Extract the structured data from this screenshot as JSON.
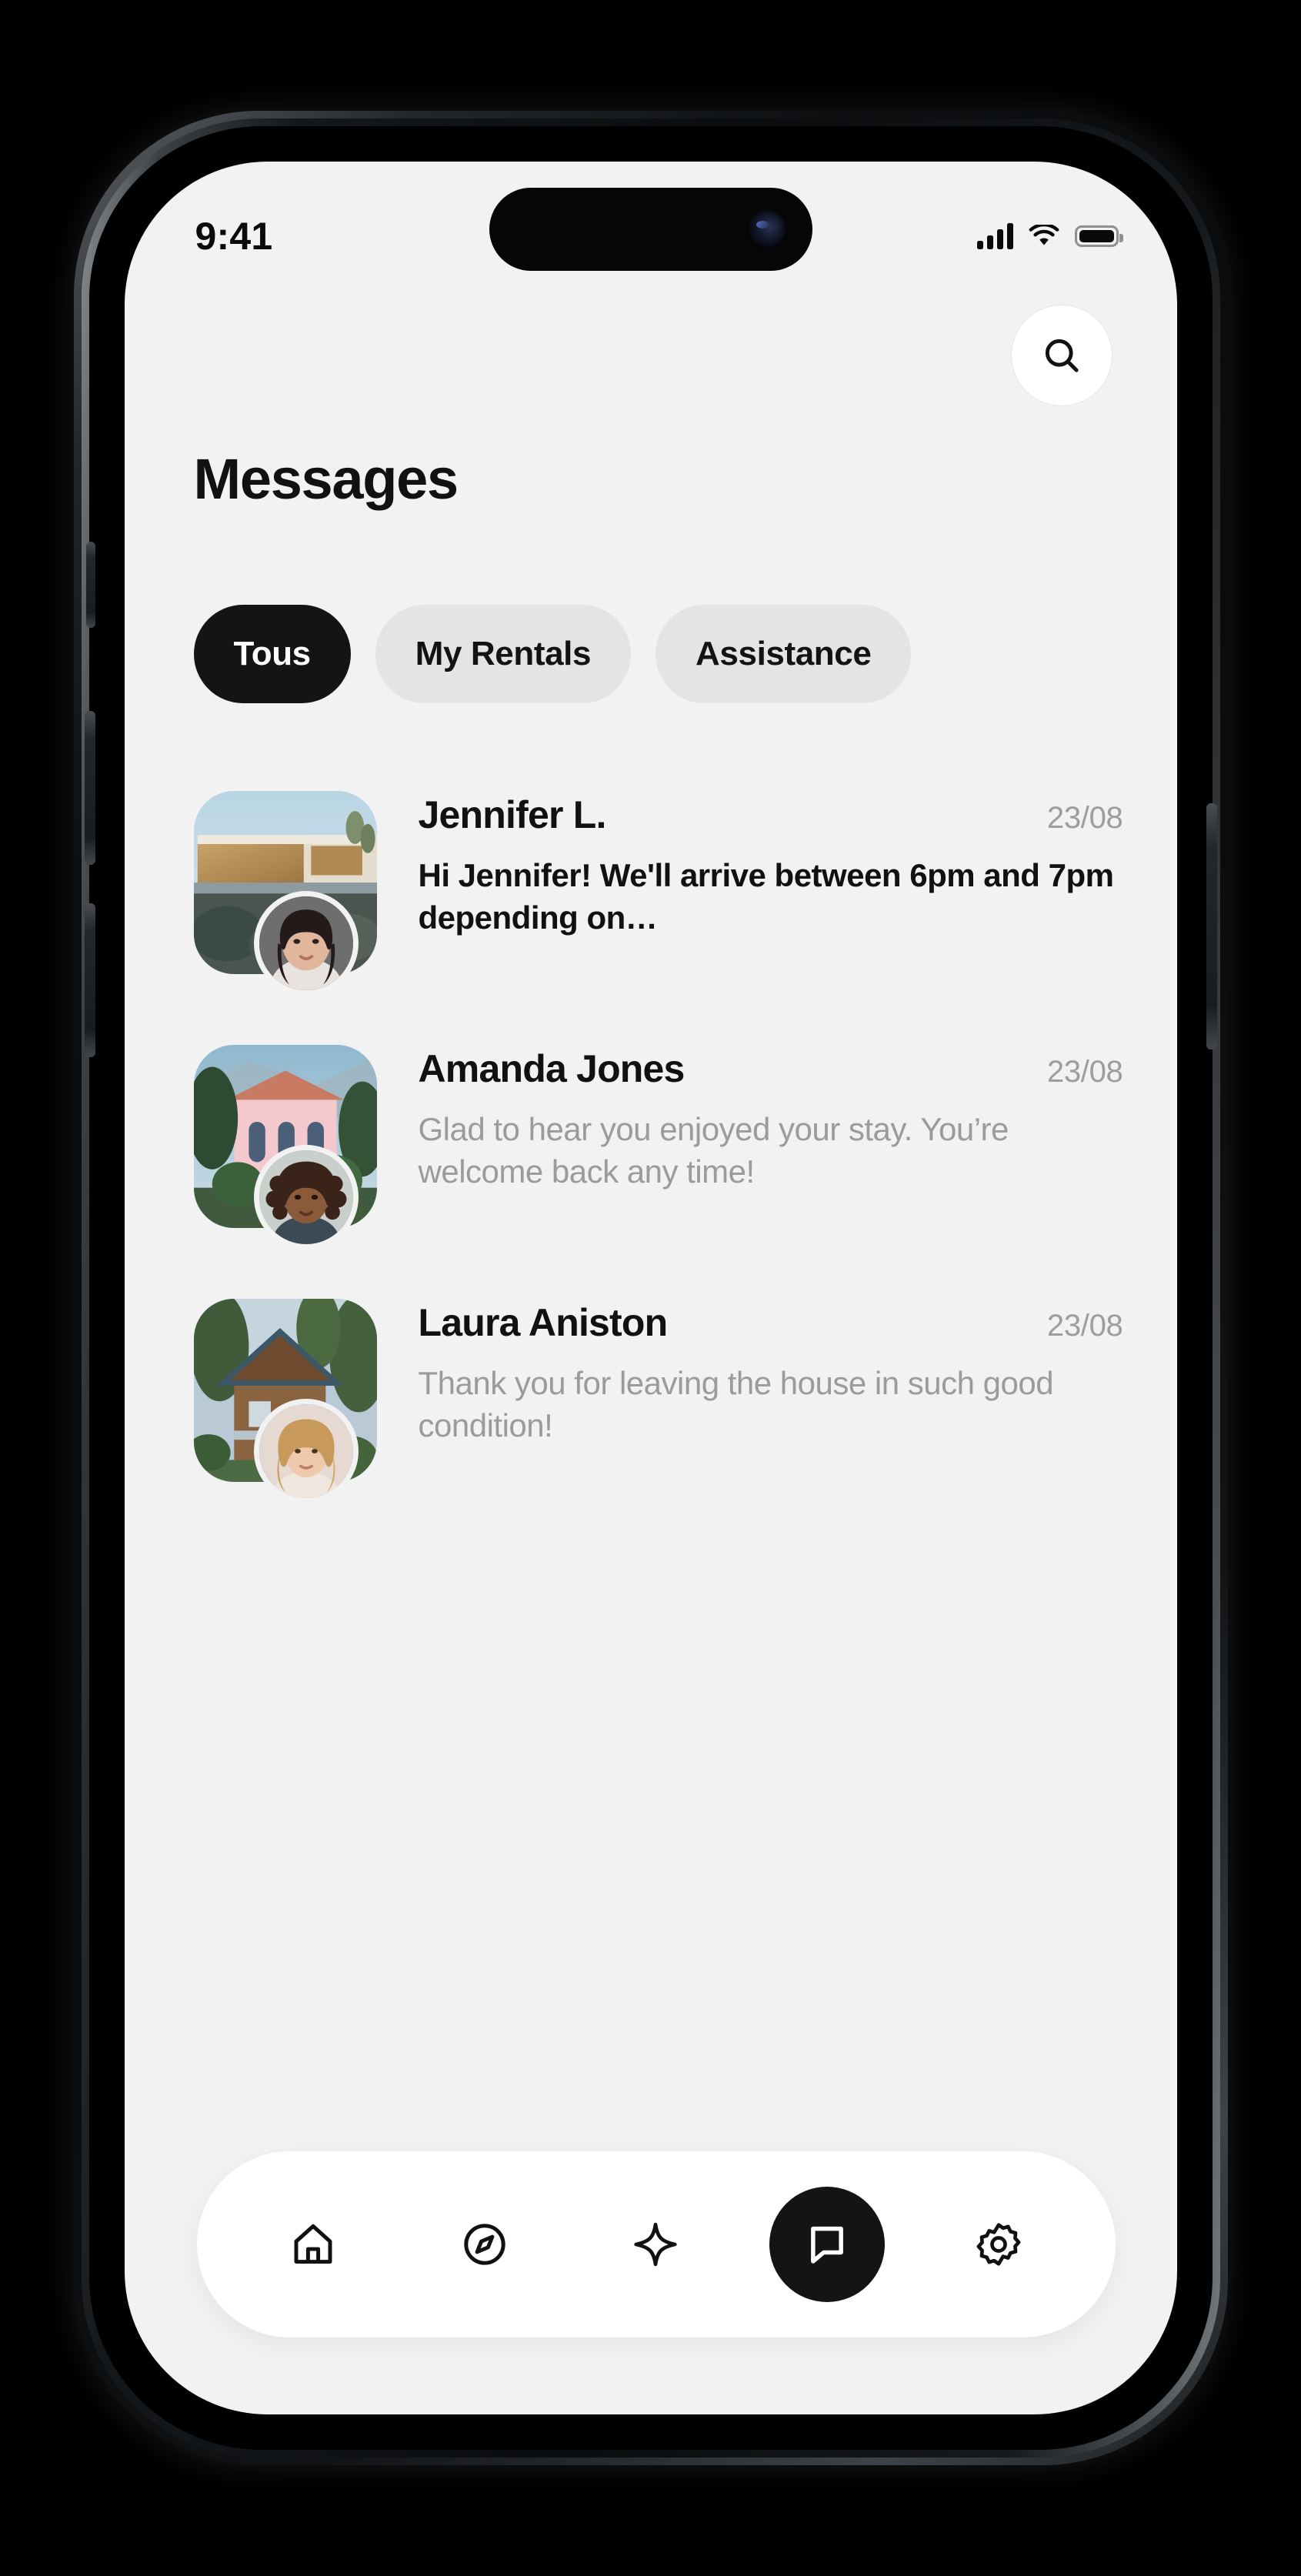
{
  "status_bar": {
    "time": "9:41",
    "signal_icon": "cellular-signal-icon",
    "wifi_icon": "wifi-icon",
    "battery_icon": "battery-full-icon"
  },
  "header": {
    "title": "Messages",
    "search_icon": "search-icon"
  },
  "tabs": [
    {
      "label": "Tous",
      "active": true
    },
    {
      "label": "My Rentals",
      "active": false
    },
    {
      "label": "Assistance",
      "active": false
    }
  ],
  "conversations": [
    {
      "name": "Jennifer L.",
      "date": "23/08",
      "preview": "Hi Jennifer! We'll arrive between 6pm and 7pm depending on…",
      "unread": true,
      "property_image": "modern-desert-villa-thumbnail",
      "avatar_image": "jennifer-avatar"
    },
    {
      "name": "Amanda Jones",
      "date": "23/08",
      "preview": "Glad to hear you enjoyed your stay. You’re welcome back any time!",
      "unread": false,
      "property_image": "pink-mediterranean-villa-thumbnail",
      "avatar_image": "amanda-avatar"
    },
    {
      "name": "Laura Aniston",
      "date": "23/08",
      "preview": "Thank you for leaving the house in such good condition!",
      "unread": false,
      "property_image": "forest-wooden-chalet-thumbnail",
      "avatar_image": "laura-avatar"
    }
  ],
  "bottom_nav": [
    {
      "icon": "home-icon",
      "active": false
    },
    {
      "icon": "compass-icon",
      "active": false
    },
    {
      "icon": "sparkle-icon",
      "active": false
    },
    {
      "icon": "chat-bubble-icon",
      "active": true
    },
    {
      "icon": "gear-icon",
      "active": false
    }
  ],
  "colors": {
    "screen_background": "#f2f2f2",
    "accent_dark": "#141414",
    "tab_inactive": "#e4e4e4",
    "muted_text": "#9b9b9b",
    "card_white": "#ffffff"
  }
}
